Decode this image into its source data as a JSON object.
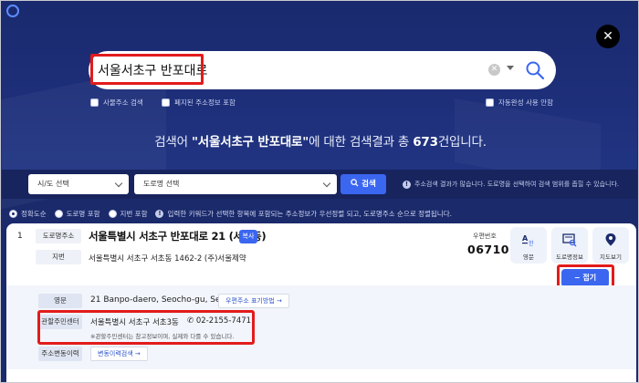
{
  "search": {
    "value": "서울서초구 반포대로",
    "options": {
      "old_address": "사물주소 검색",
      "abolished": "폐지된 주소정보 포함",
      "autocomplete": "자동완성 사용 안함"
    }
  },
  "summary": {
    "prefix": "검색어 ",
    "query": "\"서울서초구 반포대로\"",
    "middle": "에 대한 검색결과 총 ",
    "count": "673",
    "suffix": "건입니다."
  },
  "filters": {
    "sido": "시/도 선택",
    "road": "도로명 선택",
    "search_button": "검색",
    "hint": "주소검색 결과가 많습니다. 도로명을 선택하여 검색 범위를 좁힐 수 있습니다."
  },
  "sort": {
    "options": [
      "정확도순",
      "도로명 포함",
      "지번 포함"
    ],
    "selected_index": 0,
    "hint": "입력한 키워드가 선택한 항목에 포함되는 주소정보가 우선정렬 되고, 도로명주소 순으로 정렬됩니다."
  },
  "result": {
    "index": "1",
    "road_label": "도로명주소",
    "road_address": "서울특별시 서초구 반포대로 21 (서초동)",
    "copy": "복사",
    "jibun_label": "지번",
    "jibun_address": "서울특별시 서초구 서초동 1462-2 (주)서울제약",
    "postal_label": "우편번호",
    "postal_code": "06710",
    "tools": [
      "영문",
      "도로명정보",
      "지도보기"
    ],
    "fold_button": "접기"
  },
  "detail": {
    "english_label": "영문",
    "english_address": "21 Banpo-daero, Seocho-gu, Seoul",
    "english_link": "우편주소 표기방법 →",
    "center_label": "관할주민센터",
    "center_name": "서울특별시 서초구 서초3동",
    "phone": "02-2155-7471",
    "center_note": "※관할주민센터는 참고정보이며, 실제와 다를 수 있습니다.",
    "history_label": "주소변동이력",
    "history_link": "변동이력검색 →"
  },
  "colors": {
    "hero": "#1b2a6b",
    "accent": "#3a66f0",
    "highlight": "#e21b1b"
  }
}
